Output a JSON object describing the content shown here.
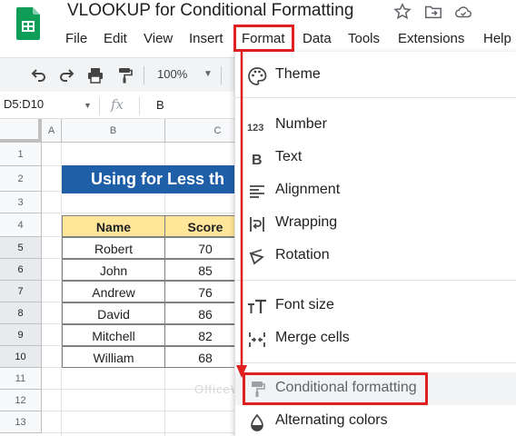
{
  "app": {
    "title": "VLOOKUP for Conditional Formatting",
    "brand_color": "#0f9d58"
  },
  "menu": {
    "items": [
      "File",
      "Edit",
      "View",
      "Insert",
      "Format",
      "Data",
      "Tools",
      "Extensions",
      "Help"
    ],
    "active": "Format"
  },
  "toolbar": {
    "icons": [
      "undo-icon",
      "redo-icon",
      "print-icon",
      "paint-format-icon"
    ],
    "zoom": "100%"
  },
  "formula_bar": {
    "name_box": "D5:D10",
    "fx": "fx",
    "value": "B"
  },
  "grid": {
    "columns": [
      "A",
      "B",
      "C"
    ],
    "rows": [
      "1",
      "2",
      "3",
      "4",
      "5",
      "6",
      "7",
      "8",
      "9",
      "10",
      "11",
      "12",
      "13"
    ],
    "selected_rows": [
      "5",
      "6",
      "7",
      "8",
      "9",
      "10"
    ],
    "banner_text": "Using for Less th",
    "banner_color": "#1f5fa8",
    "header_fill": "#ffe699",
    "table": {
      "headers": [
        "Name",
        "Score"
      ],
      "rows": [
        [
          "Robert",
          "70"
        ],
        [
          "John",
          "85"
        ],
        [
          "Andrew",
          "76"
        ],
        [
          "David",
          "86"
        ],
        [
          "Mitchell",
          "82"
        ],
        [
          "William",
          "68"
        ]
      ]
    }
  },
  "format_menu": {
    "groups": [
      [
        {
          "label": "Theme",
          "icon": "palette-icon"
        }
      ],
      [
        {
          "label": "Number",
          "icon": "number-123-icon"
        },
        {
          "label": "Text",
          "icon": "bold-icon"
        },
        {
          "label": "Alignment",
          "icon": "align-left-icon"
        },
        {
          "label": "Wrapping",
          "icon": "text-wrap-icon"
        },
        {
          "label": "Rotation",
          "icon": "text-rotation-icon"
        }
      ],
      [
        {
          "label": "Font size",
          "icon": "font-size-icon"
        },
        {
          "label": "Merge cells",
          "icon": "merge-cells-icon"
        }
      ],
      [
        {
          "label": "Conditional formatting",
          "icon": "conditional-format-icon",
          "highlighted": true
        },
        {
          "label": "Alternating colors",
          "icon": "alternating-colors-icon"
        }
      ]
    ]
  },
  "annotation_color": "#e02020",
  "watermark": "OfficeWheel"
}
